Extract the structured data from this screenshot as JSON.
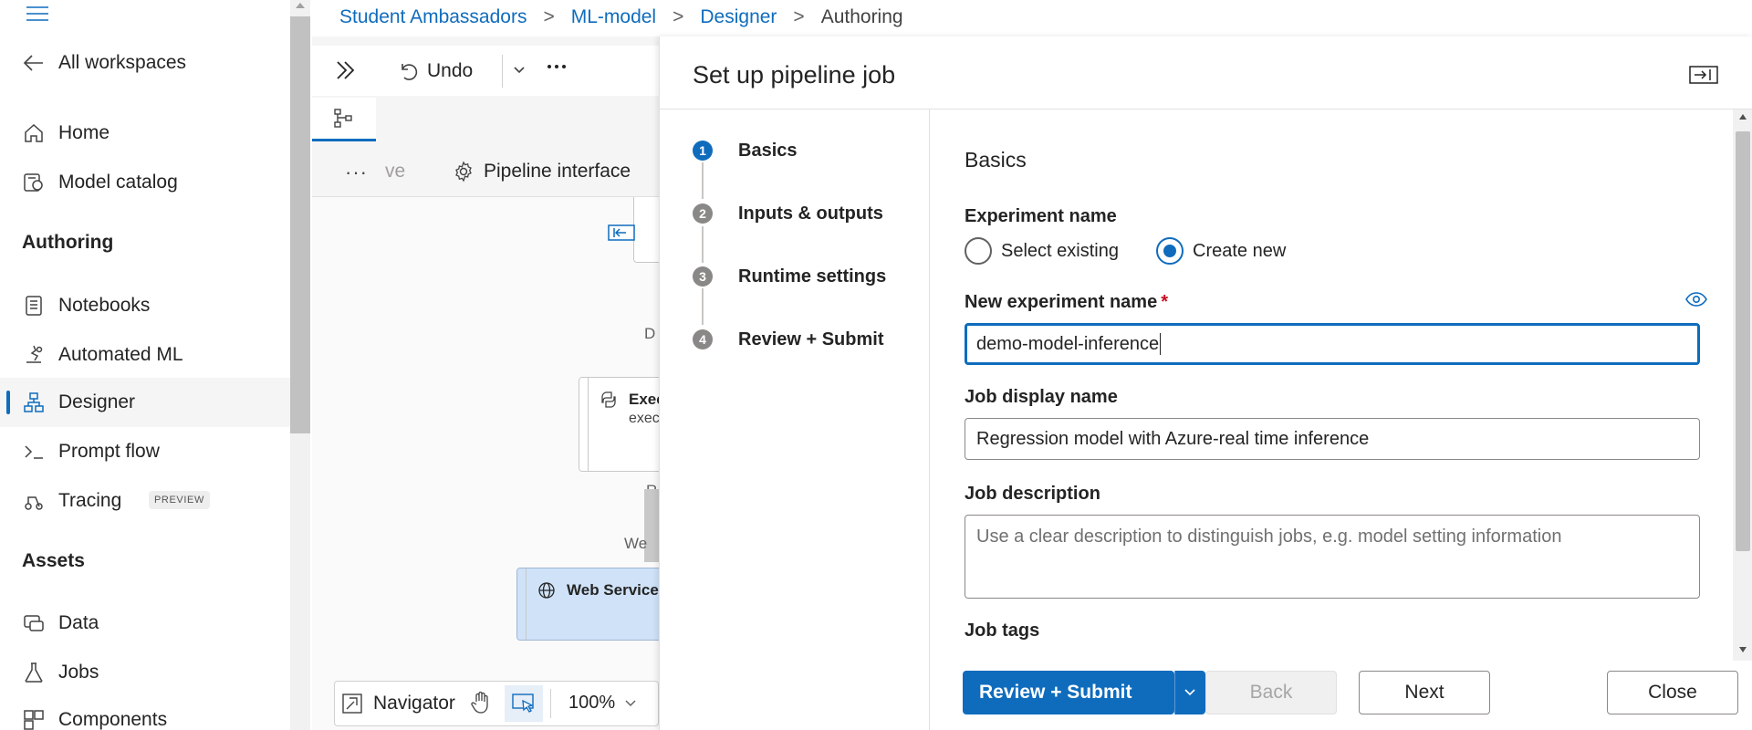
{
  "nav": {
    "back_label": "All workspaces",
    "items_top": [
      {
        "label": "Home",
        "icon": "home-icon"
      },
      {
        "label": "Model catalog",
        "icon": "model-catalog-icon"
      }
    ],
    "section_authoring": "Authoring",
    "items_authoring": [
      {
        "label": "Notebooks",
        "icon": "notebook-icon"
      },
      {
        "label": "Automated ML",
        "icon": "automated-ml-icon"
      },
      {
        "label": "Designer",
        "icon": "designer-icon",
        "active": true
      },
      {
        "label": "Prompt flow",
        "icon": "prompt-flow-icon"
      },
      {
        "label": "Tracing",
        "icon": "tracing-icon",
        "badge": "PREVIEW"
      }
    ],
    "section_assets": "Assets",
    "items_assets": [
      {
        "label": "Data",
        "icon": "data-icon"
      },
      {
        "label": "Jobs",
        "icon": "jobs-icon"
      },
      {
        "label": "Components",
        "icon": "components-icon"
      }
    ]
  },
  "breadcrumb": {
    "items": [
      "Student Ambassadors",
      "ML-model",
      "Designer"
    ],
    "current": "Authoring",
    "separator": ">"
  },
  "designer": {
    "toolbar": {
      "undo_label": "Undo",
      "more": "···"
    },
    "subbar": {
      "more": "···",
      "truncated_label": "ve",
      "pipeline_interface_label": "Pipeline interface"
    },
    "canvas": {
      "fragment_d": "D",
      "node_execute_title": "Exec",
      "node_execute_sub": "exec",
      "fragment_r": "R",
      "fragment_we": "We",
      "node_web_service_title": "Web Service"
    },
    "bottombar": {
      "navigator_label": "Navigator",
      "zoom": "100%"
    }
  },
  "panel": {
    "title": "Set up pipeline job",
    "steps": [
      {
        "number": "1",
        "label": "Basics",
        "current": true
      },
      {
        "number": "2",
        "label": "Inputs & outputs",
        "current": false
      },
      {
        "number": "3",
        "label": "Runtime settings",
        "current": false
      },
      {
        "number": "4",
        "label": "Review + Submit",
        "current": false
      }
    ],
    "form": {
      "heading": "Basics",
      "experiment_name_label": "Experiment name",
      "radio_select_existing": "Select existing",
      "radio_create_new": "Create new",
      "selected_radio": "Create new",
      "new_experiment_name_label": "New experiment name",
      "required_mark": "*",
      "new_experiment_name_value": "demo-model-inference",
      "job_display_name_label": "Job display name",
      "job_display_name_value": "Regression model with Azure-real time inference",
      "job_description_label": "Job description",
      "job_description_placeholder": "Use a clear description to distinguish jobs, e.g. model setting information",
      "job_tags_label": "Job tags"
    },
    "footer": {
      "review_submit": "Review + Submit",
      "back": "Back",
      "next": "Next",
      "close": "Close"
    }
  },
  "colors": {
    "accent": "#0f6cbd",
    "disabled_text": "#a6a6a6",
    "required": "#c50f1f",
    "selected_node": "#cfe2f7"
  }
}
